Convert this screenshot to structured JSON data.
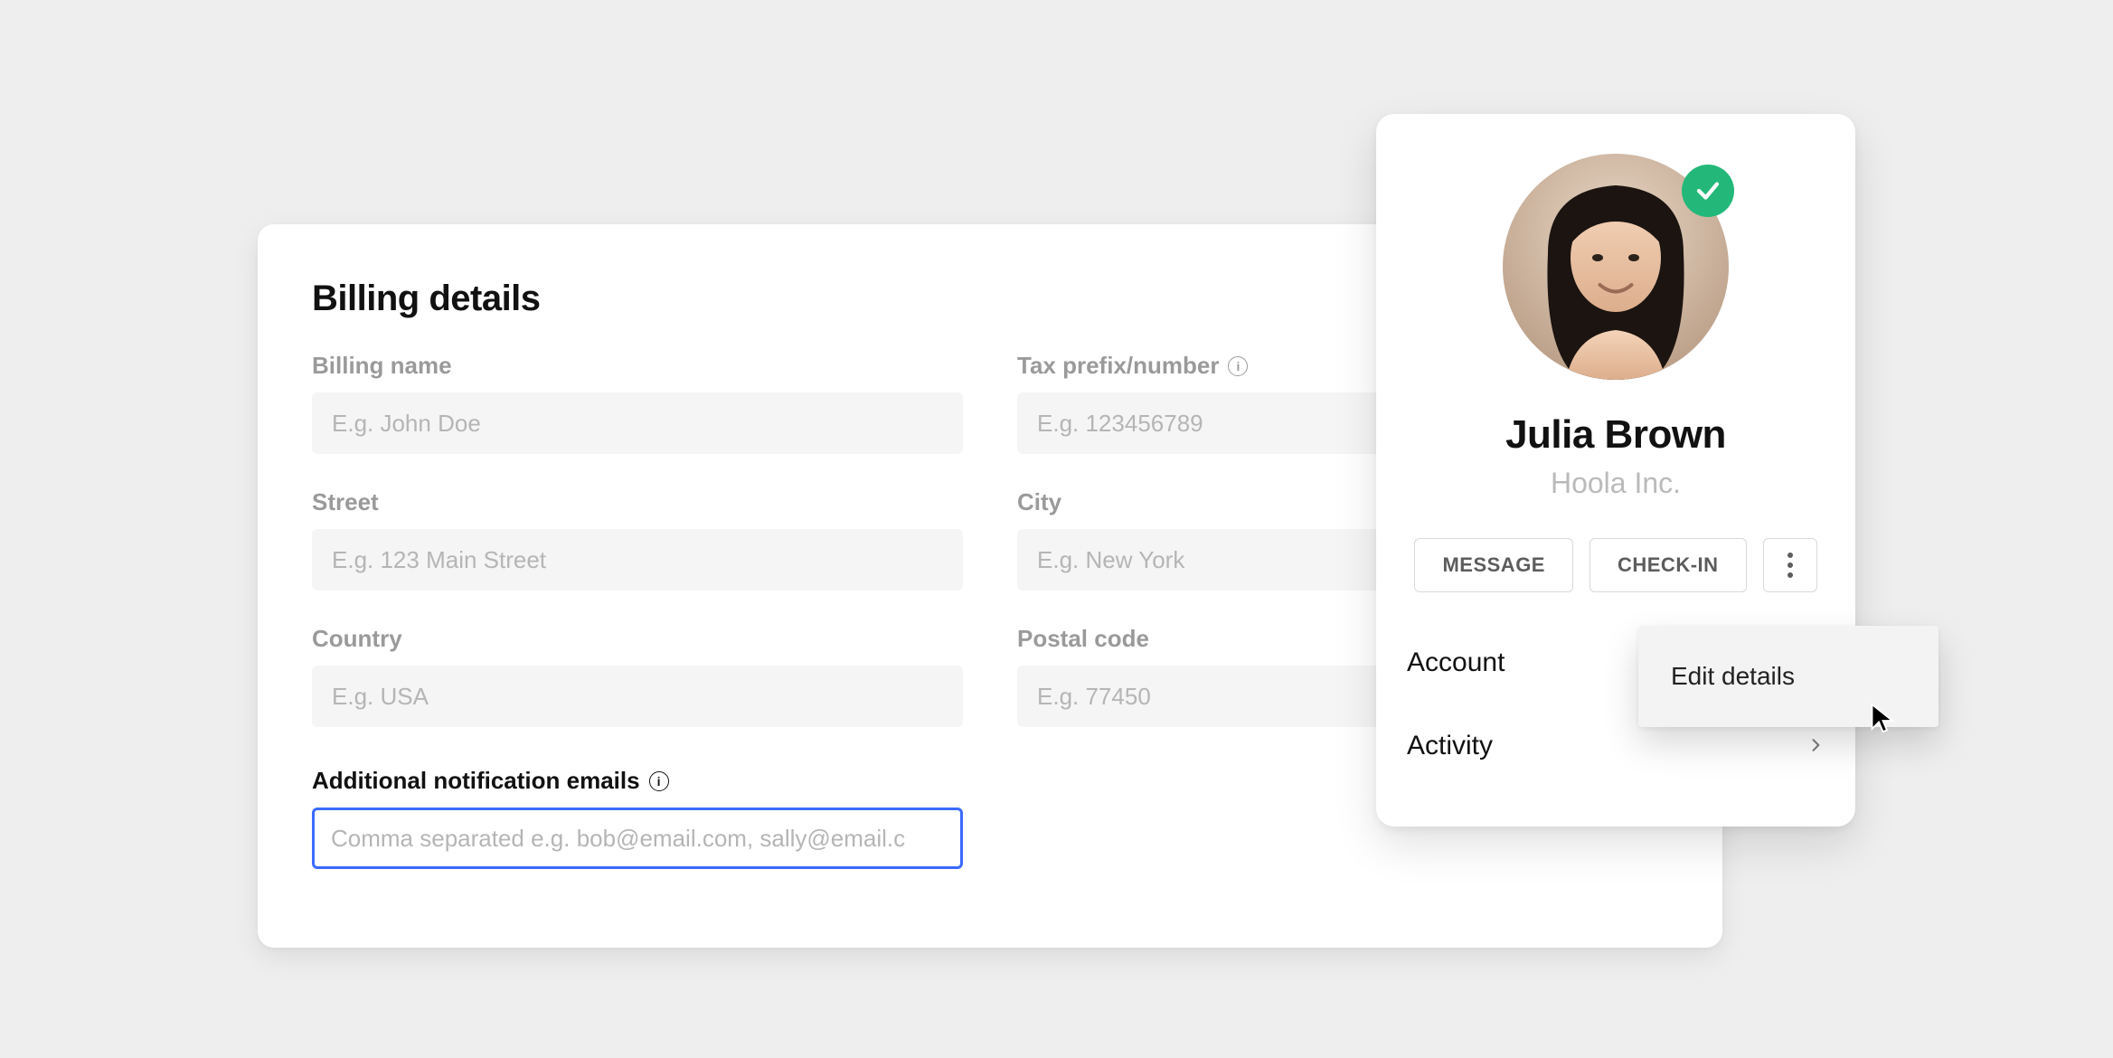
{
  "billing": {
    "title": "Billing details",
    "fields": {
      "billing_name": {
        "label": "Billing name",
        "placeholder": "E.g. John Doe",
        "value": ""
      },
      "tax_prefix": {
        "label": "Tax prefix/number",
        "placeholder": "E.g. 123456789",
        "value": ""
      },
      "street": {
        "label": "Street",
        "placeholder": "E.g. 123 Main Street",
        "value": ""
      },
      "city": {
        "label": "City",
        "placeholder": "E.g. New York",
        "value": ""
      },
      "country": {
        "label": "Country",
        "placeholder": "E.g. USA",
        "value": ""
      },
      "postal_code": {
        "label": "Postal code",
        "placeholder": "E.g. 77450",
        "value": ""
      }
    },
    "notification": {
      "label": "Additional notification emails",
      "placeholder": "Comma separated e.g. bob@email.com, sally@email.c",
      "value": ""
    }
  },
  "profile": {
    "name": "Julia Brown",
    "company": "Hoola Inc.",
    "verified": true,
    "buttons": {
      "message": "MESSAGE",
      "checkin": "CHECK-IN"
    },
    "rows": {
      "account": "Account",
      "activity": "Activity"
    }
  },
  "popover": {
    "edit_details": "Edit details"
  },
  "colors": {
    "accent_focus": "#3b6bff",
    "verified_badge": "#23b87a"
  }
}
